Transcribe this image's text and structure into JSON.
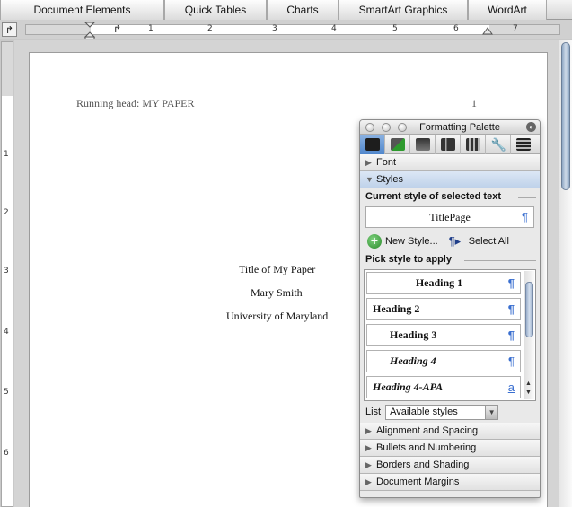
{
  "ribbon": {
    "tabs": [
      "Document Elements",
      "Quick Tables",
      "Charts",
      "SmartArt Graphics",
      "WordArt"
    ]
  },
  "ruler": {
    "tab_selector": "↱",
    "numbers": [
      "1",
      "2",
      "3",
      "4",
      "5",
      "6",
      "7"
    ],
    "vertical_numbers": [
      "1",
      "2",
      "3",
      "4",
      "5",
      "6"
    ]
  },
  "document": {
    "running_head": "Running head: MY PAPER",
    "page_number": "1",
    "title": "Title of My Paper",
    "author": "Mary Smith",
    "institution": "University of Maryland"
  },
  "palette": {
    "title": "Formatting Palette",
    "sections": {
      "font": "Font",
      "styles": "Styles",
      "alignment": "Alignment and Spacing",
      "bullets": "Bullets and Numbering",
      "borders": "Borders and Shading",
      "margins": "Document Margins"
    },
    "current_style_label": "Current style of selected text",
    "current_style": "TitlePage",
    "new_style": "New Style...",
    "select_all": "Select All",
    "pick_label": "Pick style to apply",
    "styles": [
      {
        "name": "Heading 1",
        "mark": "¶"
      },
      {
        "name": "Heading 2",
        "mark": "¶"
      },
      {
        "name": "Heading 3",
        "mark": "¶"
      },
      {
        "name": "Heading 4",
        "mark": "¶"
      },
      {
        "name": "Heading 4-APA",
        "mark": "a"
      }
    ],
    "list_label": "List",
    "list_value": "Available styles"
  }
}
